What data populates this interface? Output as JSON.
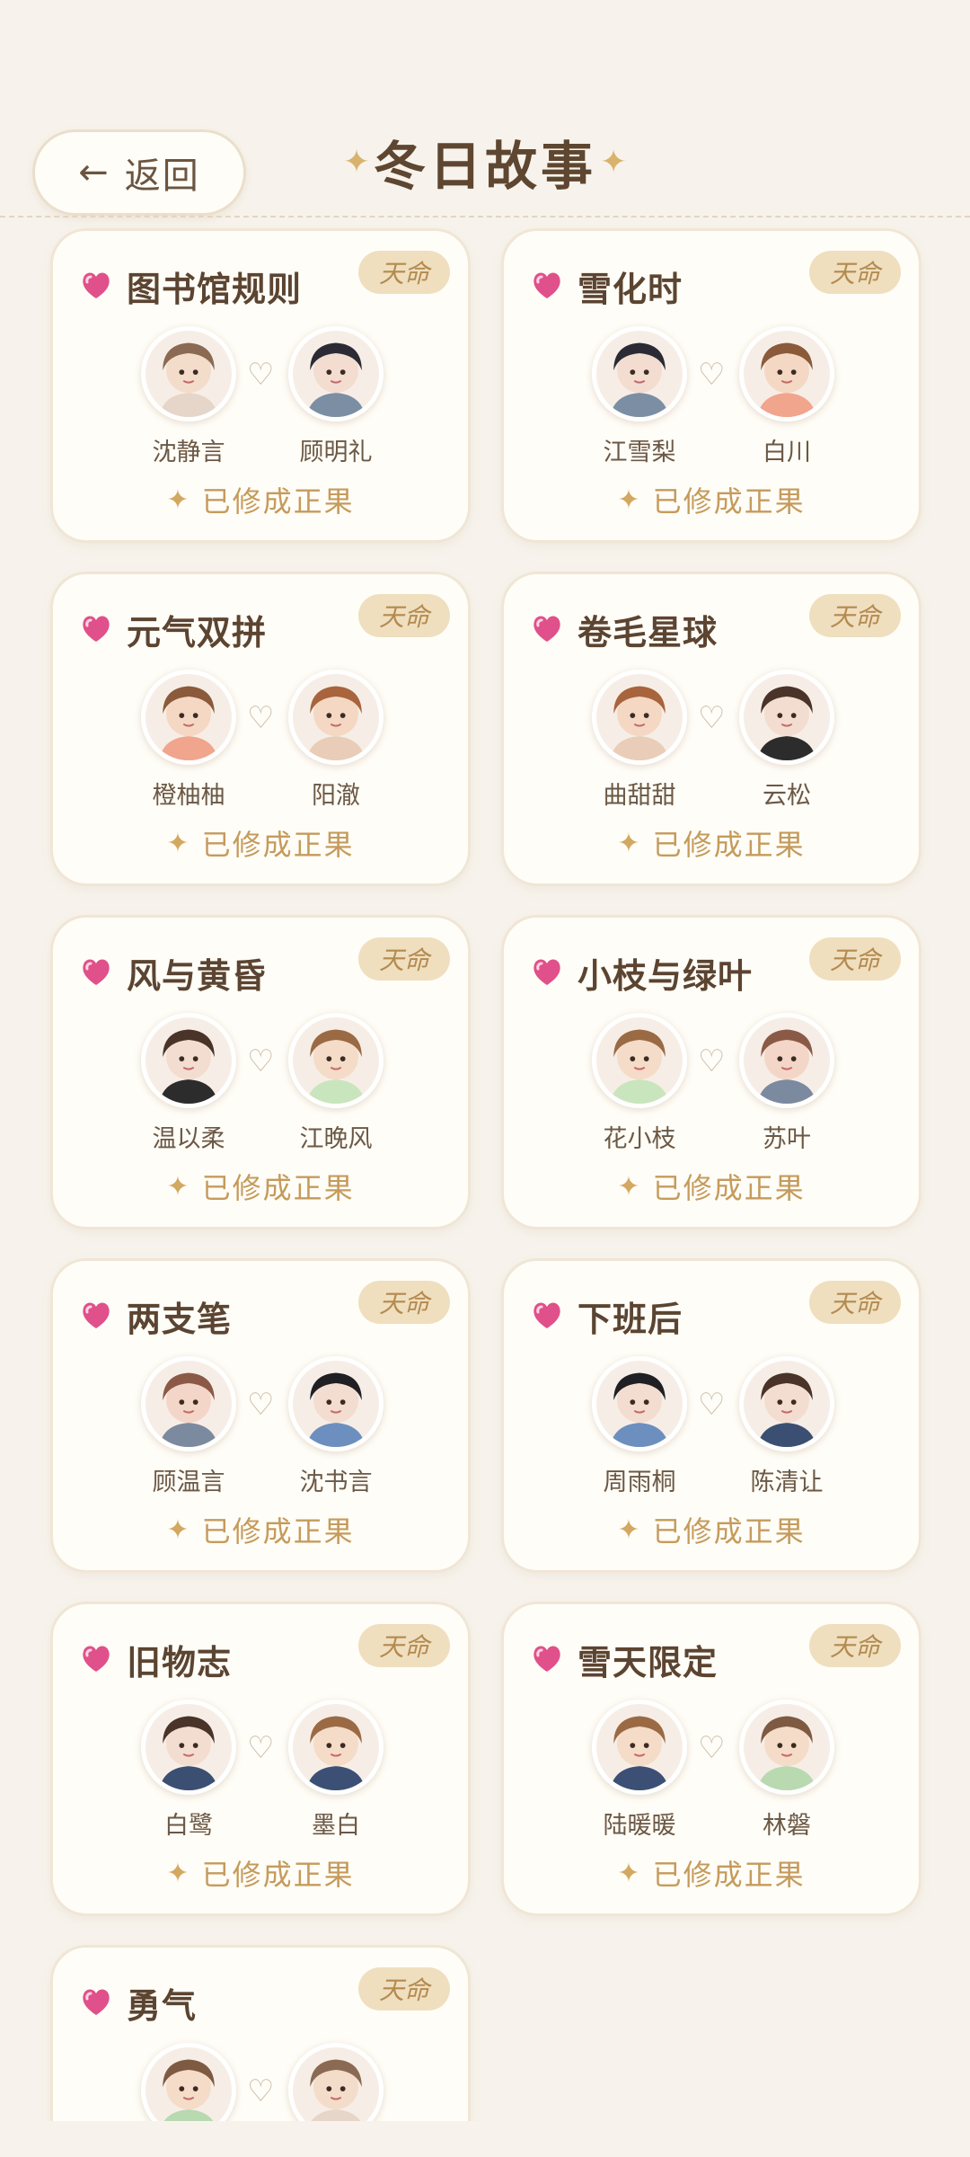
{
  "header": {
    "back_arrow": "←",
    "back_label": "返回",
    "title": "冬日故事",
    "title_star": "✦"
  },
  "colors": {
    "background": "#f7f3ec",
    "card": "#fffdf7",
    "badge": "#efdfbf",
    "accent_gold": "#c59b5c",
    "heart_pink": "#e0508a"
  },
  "cards": [
    {
      "title": "图书馆规则",
      "badge": "天命",
      "left_name": "沈静言",
      "right_name": "顾明礼",
      "status": "已修成正果"
    },
    {
      "title": "雪化时",
      "badge": "天命",
      "left_name": "江雪梨",
      "right_name": "白川",
      "status": "已修成正果"
    },
    {
      "title": "元气双拼",
      "badge": "天命",
      "left_name": "橙柚柚",
      "right_name": "阳澈",
      "status": "已修成正果"
    },
    {
      "title": "卷毛星球",
      "badge": "天命",
      "left_name": "曲甜甜",
      "right_name": "云松",
      "status": "已修成正果"
    },
    {
      "title": "风与黄昏",
      "badge": "天命",
      "left_name": "温以柔",
      "right_name": "江晚风",
      "status": "已修成正果"
    },
    {
      "title": "小枝与绿叶",
      "badge": "天命",
      "left_name": "花小枝",
      "right_name": "苏叶",
      "status": "已修成正果"
    },
    {
      "title": "两支笔",
      "badge": "天命",
      "left_name": "顾温言",
      "right_name": "沈书言",
      "status": "已修成正果"
    },
    {
      "title": "下班后",
      "badge": "天命",
      "left_name": "周雨桐",
      "right_name": "陈清让",
      "status": "已修成正果"
    },
    {
      "title": "旧物志",
      "badge": "天命",
      "left_name": "白鹭",
      "right_name": "墨白",
      "status": "已修成正果"
    },
    {
      "title": "雪天限定",
      "badge": "天命",
      "left_name": "陆暖暖",
      "right_name": "林磐",
      "status": "已修成正果"
    },
    {
      "title": "勇气",
      "badge": "天命",
      "left_name": "",
      "right_name": "",
      "status": ""
    }
  ],
  "icons": {
    "card_heart": "pink-heart-icon",
    "pair_heart": "outline-heart-icon",
    "sparkle": "sparkle-icon"
  }
}
